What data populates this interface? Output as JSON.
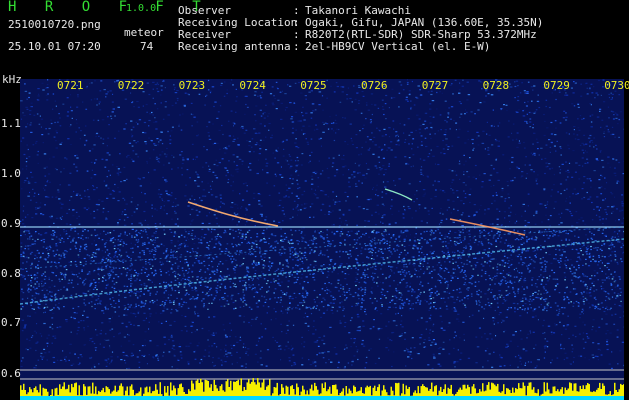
{
  "app": {
    "name": "H R O F F T",
    "version": "1.0.0"
  },
  "file_name": "2510010720.png",
  "meteor": {
    "label": "meteor",
    "count": "74"
  },
  "datetime": "25.10.01 07:20",
  "info": [
    {
      "label": "Observer",
      "value": "Takanori Kawachi"
    },
    {
      "label": "Receiving Location",
      "value": "Ogaki, Gifu, JAPAN (136.60E, 35.35N)"
    },
    {
      "label": "Receiver",
      "value": "R820T2(RTL-SDR) SDR-Sharp 53.372MHz"
    },
    {
      "label": "Receiving antenna",
      "value": "2el-HB9CV Vertical (el. E-W)"
    }
  ],
  "separator": ":",
  "axis": {
    "y_unit": "kHz",
    "y_ticks": [
      "1.1",
      "1.0",
      "0.9",
      "0.8",
      "0.7",
      "0.6"
    ],
    "x_ticks": [
      "0721",
      "0722",
      "0723",
      "0724",
      "0725",
      "0726",
      "0727",
      "0728",
      "0729",
      "0730"
    ]
  },
  "colors": {
    "background": "#000000",
    "title_green": "#33dd33",
    "tick_yellow": "#f0f020",
    "spectrum_bg": "#071255",
    "level_bars": "#f5f000",
    "level_base": "#00d8ff"
  },
  "chart_data": {
    "type": "heatmap",
    "y_unit": "kHz",
    "ylim": [
      0.6,
      1.1
    ],
    "x_categories": [
      "0721",
      "0722",
      "0723",
      "0724",
      "0725",
      "0726",
      "0727",
      "0728",
      "0729",
      "0730"
    ]
  }
}
